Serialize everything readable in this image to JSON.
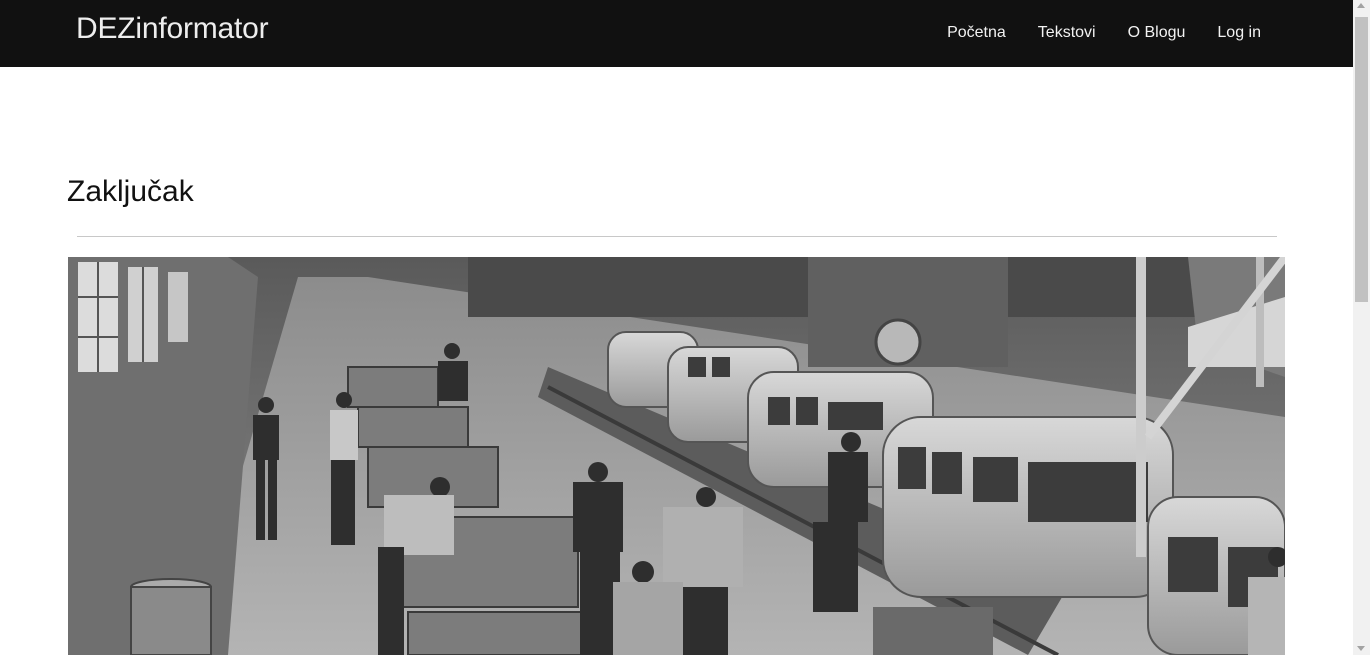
{
  "nav": {
    "brand": "DEZinformator",
    "links": [
      {
        "label": "Početna"
      },
      {
        "label": "Tekstovi"
      },
      {
        "label": "O Blogu"
      },
      {
        "label": "Log in"
      }
    ]
  },
  "post": {
    "title": "Zaključak"
  },
  "colors": {
    "navbar_bg": "#111111",
    "nav_text": "#f2f2f2",
    "divider": "#c8c8c8"
  },
  "hero_image": {
    "icon": "factory-assembly-line-photo"
  }
}
